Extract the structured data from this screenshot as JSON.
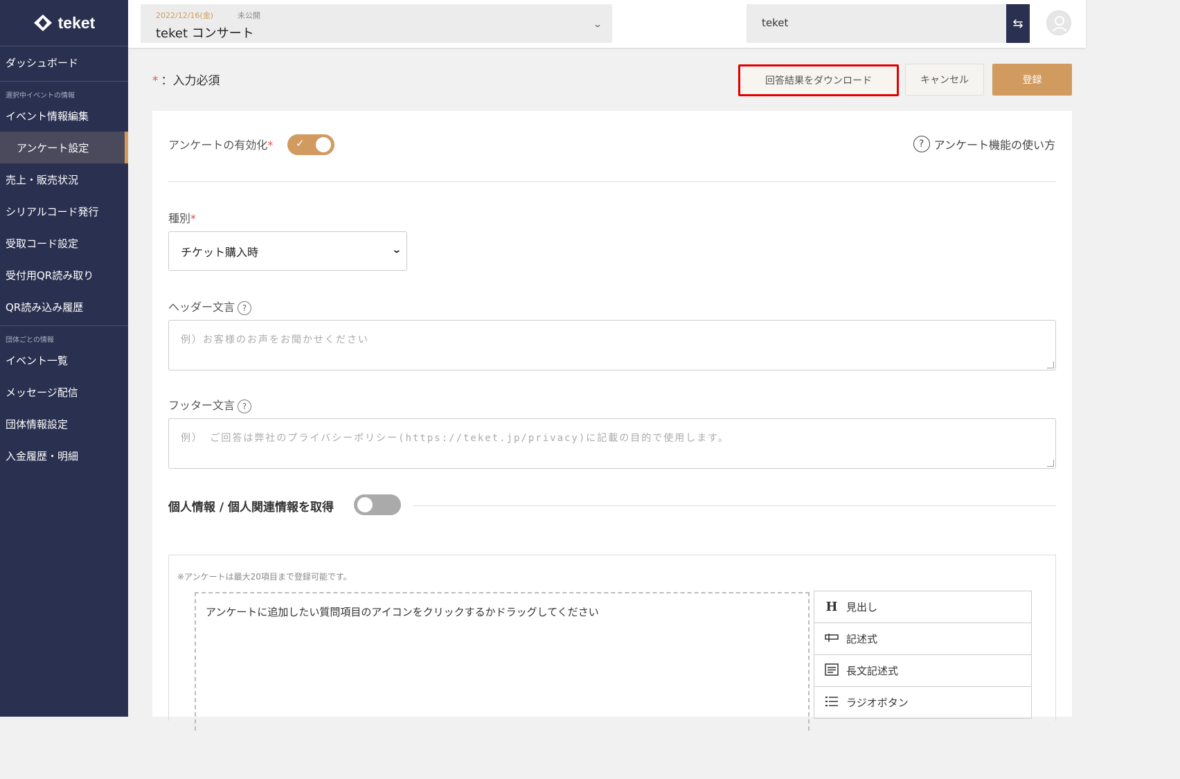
{
  "sidebar": {
    "logo": "teket",
    "items": [
      {
        "label": "ダッシュボード"
      },
      {
        "section": "選択中イベントの情報"
      },
      {
        "label": "イベント情報編集"
      },
      {
        "label": "アンケート設定",
        "active": true
      },
      {
        "label": "売上・販売状況"
      },
      {
        "label": "シリアルコード発行"
      },
      {
        "label": "受取コード設定"
      },
      {
        "label": "受付用QR読み取り"
      },
      {
        "label": "QR読み込み履歴"
      },
      {
        "section": "団体ごとの情報"
      },
      {
        "label": "イベント一覧"
      },
      {
        "label": "メッセージ配信"
      },
      {
        "label": "団体情報設定"
      },
      {
        "label": "入金履歴・明細"
      }
    ]
  },
  "header": {
    "event_date": "2022/12/16(金)",
    "event_status": "未公開",
    "event_title": "teket コンサート",
    "org_name": "teket"
  },
  "actions": {
    "required_note": "：入力必須",
    "download_label": "回答結果をダウンロード",
    "cancel_label": "キャンセル",
    "register_label": "登録"
  },
  "form": {
    "enable_label": "アンケートの有効化",
    "enable_on": true,
    "help_link": "アンケート機能の使い方",
    "type_label": "種別",
    "type_value": "チケット購入時",
    "header_label": "ヘッダー文言",
    "header_placeholder": "例）お客様のお声をお聞かせください",
    "footer_label": "フッター文言",
    "footer_placeholder": "例） ご回答は弊社のプライバシーポリシー(https://teket.jp/privacy)に記載の目的で使用します。",
    "personal_label": "個人情報 / 個人関連情報を取得",
    "personal_on": false
  },
  "builder": {
    "note": "※アンケートは最大20項目まで登録可能です。",
    "dropzone_text": "アンケートに追加したい質問項目のアイコンをクリックするかドラッグしてください",
    "palette": [
      {
        "icon": "heading-icon",
        "label": "見出し"
      },
      {
        "icon": "short-text-icon",
        "label": "記述式"
      },
      {
        "icon": "long-text-icon",
        "label": "長文記述式"
      },
      {
        "icon": "radio-list-icon",
        "label": "ラジオボタン"
      }
    ]
  },
  "colors": {
    "sidebar_bg": "#2a3150",
    "accent": "#d19a5e",
    "required": "#d9534f",
    "highlight_border": "#e30000"
  }
}
